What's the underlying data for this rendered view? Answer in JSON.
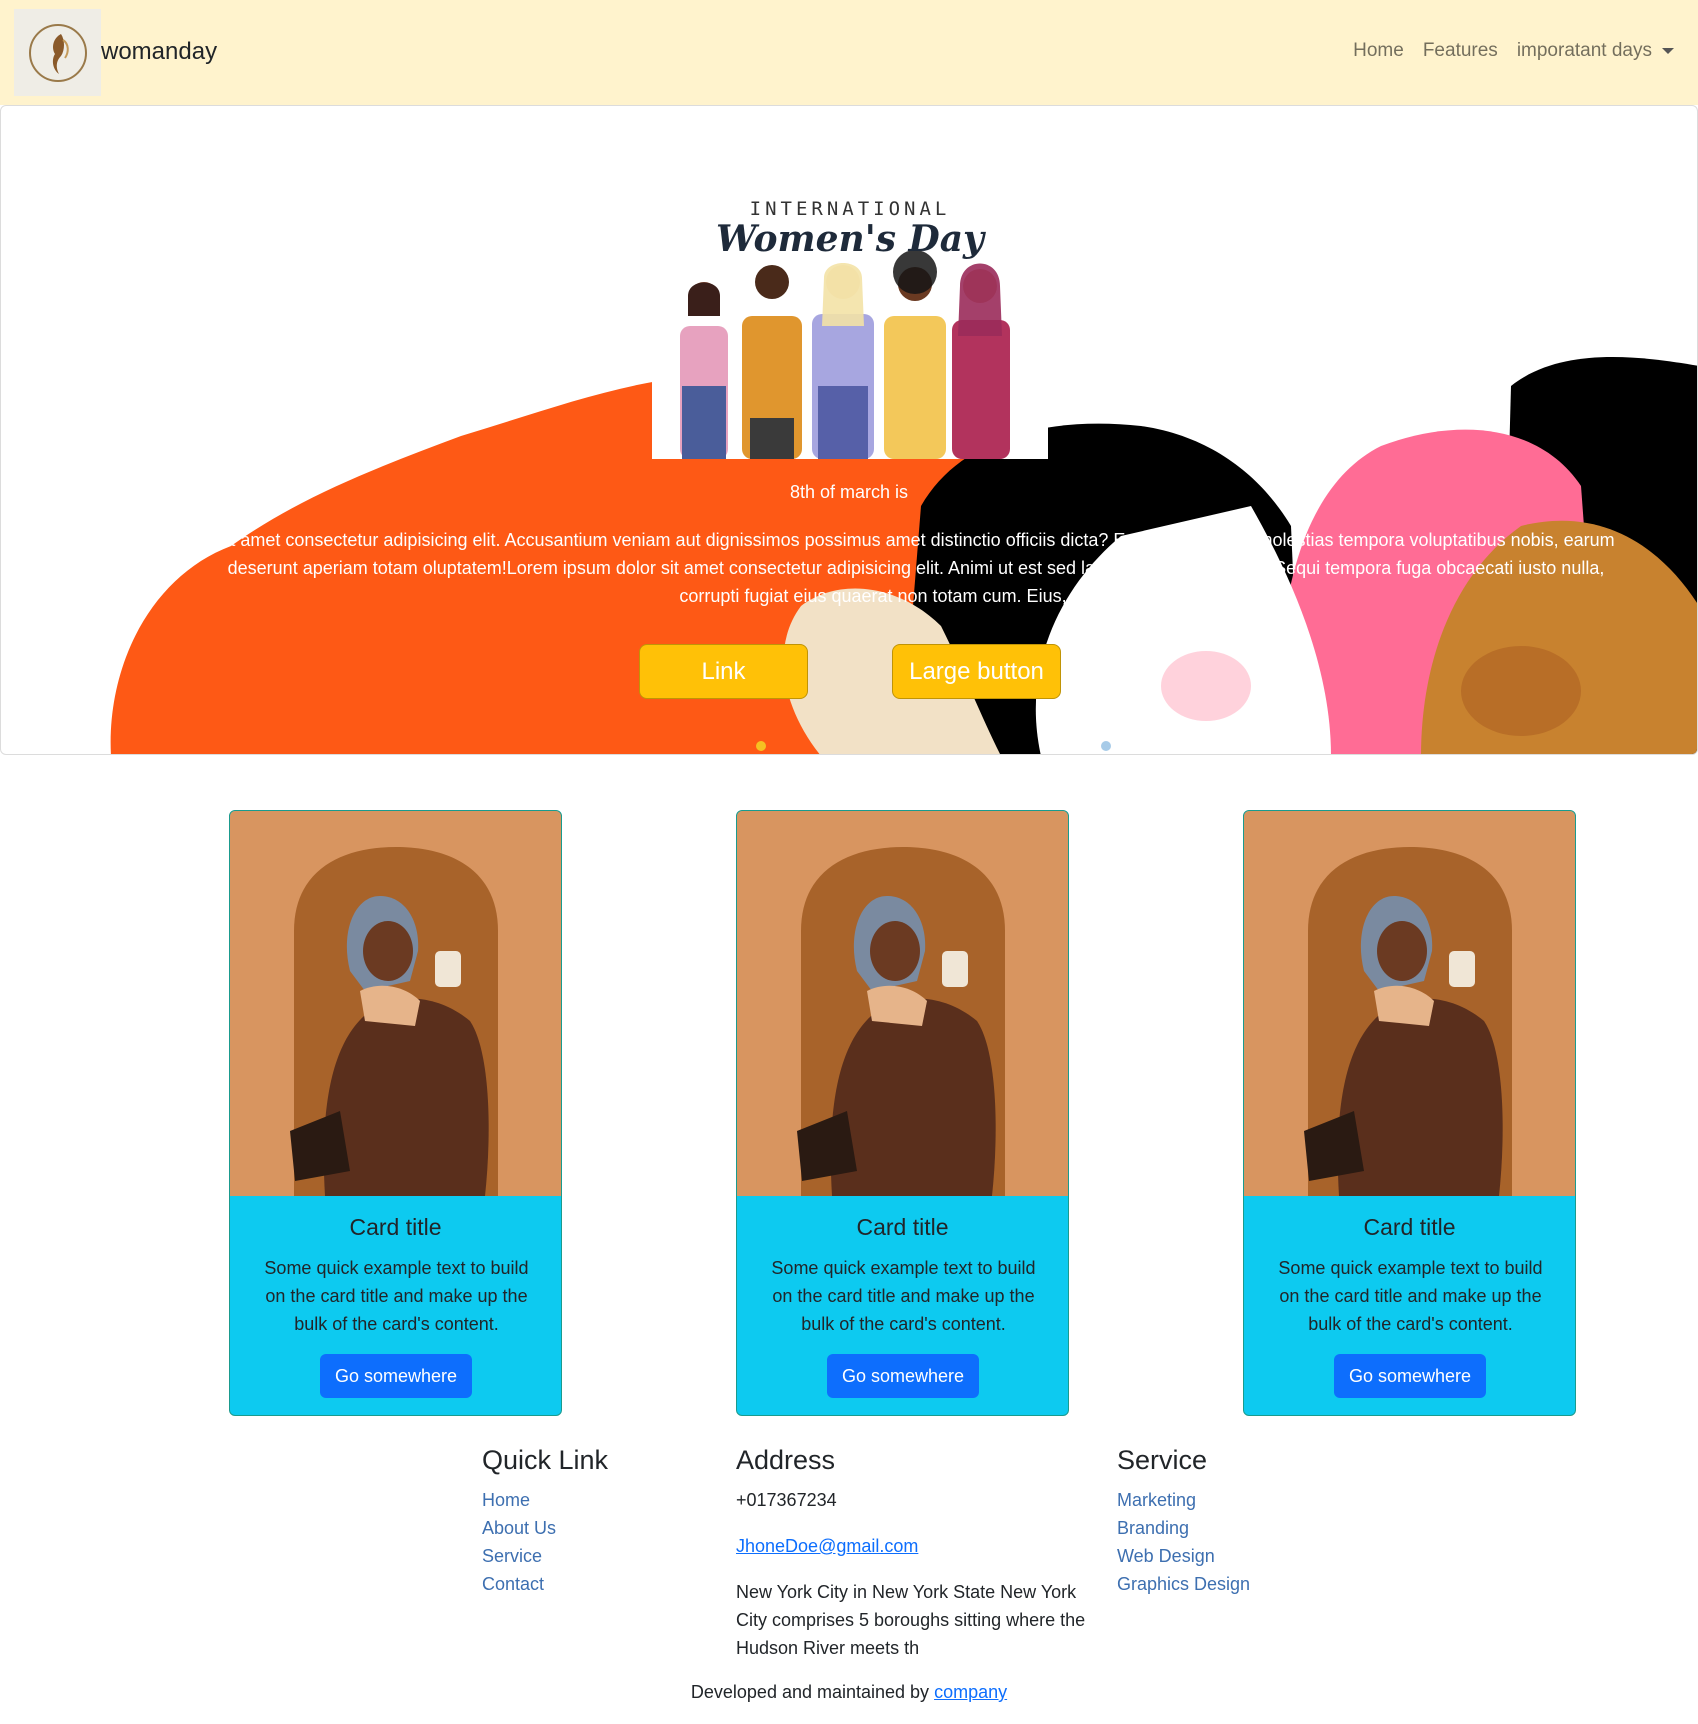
{
  "navbar": {
    "brand": "womanday",
    "links": [
      "Home",
      "Features",
      "imporatant days"
    ]
  },
  "hero": {
    "banner_line1": "INTERNATIONAL",
    "banner_line2": "Women's Day",
    "subtitle": "8th of march is",
    "text": "sit amet consectetur adipisicing elit. Accusantium veniam aut dignissimos possimus amet distinctio officiis dicta? Excepturi dolores molestias tempora voluptatibus nobis, earum deserunt aperiam totam oluptatem!Lorem ipsum dolor sit amet consectetur adipisicing elit. Animi ut est sed laboriosam perspiciatis. Sequi tempora fuga obcaecati iusto nulla, corrupti fugiat eius quaerat non totam cum. Eius, reiciendis.",
    "buttons": [
      "Link",
      "Large button"
    ]
  },
  "cards": [
    {
      "title": "Card title",
      "text": "Some quick example text to build on the card title and make up the bulk of the card's content.",
      "button": "Go somewhere"
    },
    {
      "title": "Card title",
      "text": "Some quick example text to build on the card title and make up the bulk of the card's content.",
      "button": "Go somewhere"
    },
    {
      "title": "Card title",
      "text": "Some quick example text to build on the card title and make up the bulk of the card's content.",
      "button": "Go somewhere"
    }
  ],
  "footer": {
    "quick_link": {
      "heading": "Quick Link",
      "links": [
        "Home",
        "About Us",
        "Service",
        "Contact"
      ]
    },
    "address": {
      "heading": "Address",
      "phone": "+017367234",
      "email": "JhoneDoe@gmail.com",
      "description": "New York City in New York State New York City comprises 5 boroughs sitting where the Hudson River meets th"
    },
    "service": {
      "heading": "Service",
      "links": [
        "Marketing",
        "Branding",
        "Web Design",
        "Graphics Design"
      ]
    },
    "credit_text": "Developed and maintained by ",
    "credit_link": "company"
  },
  "colors": {
    "navbar_bg": "#fff3cd",
    "hero_button": "#ffc107",
    "card_body": "#0dcaf0",
    "primary_button": "#0d6efd",
    "link": "#3d6fb0"
  },
  "icons": {
    "brand_logo": "woman-profile-logo",
    "dropdown": "caret-down-icon"
  }
}
